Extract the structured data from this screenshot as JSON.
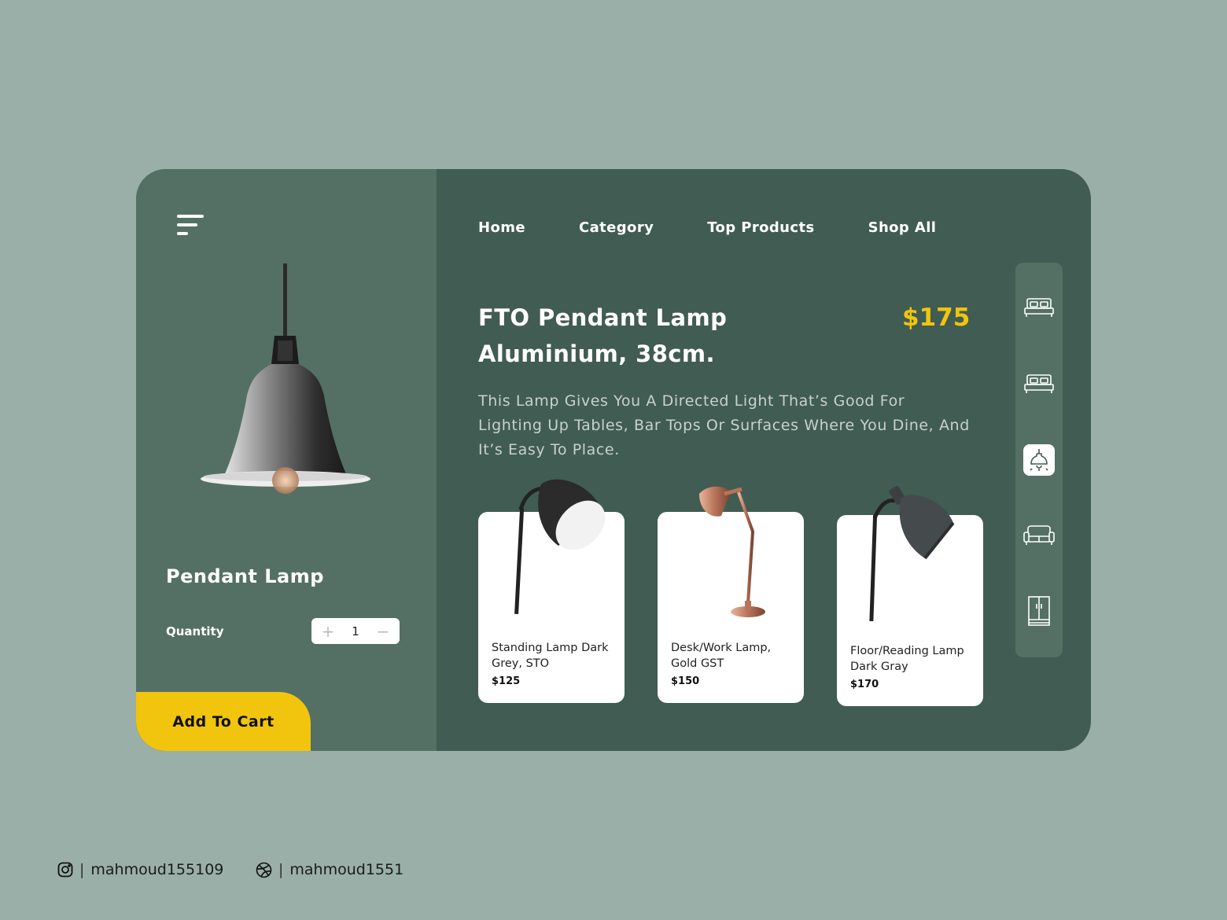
{
  "colors": {
    "accent": "#f1c50e",
    "panel_dark": "#415c52",
    "panel_light": "#547064",
    "background": "#9aafa8"
  },
  "product": {
    "name": "Pendant Lamp",
    "quantity_label": "Quantity",
    "quantity": "1",
    "plus": "+",
    "minus": "−",
    "add_to_cart": "Add To Cart"
  },
  "nav": {
    "items": [
      "Home",
      "Category",
      "Top Products",
      "Shop All"
    ]
  },
  "main": {
    "title": "FTO Pendant Lamp Aluminium, 38cm.",
    "price": "$175",
    "description": "This Lamp Gives You A Directed Light That’s Good For Lighting Up Tables, Bar Tops Or Surfaces Where You Dine, And It’s Easy To Place."
  },
  "products": [
    {
      "name": "Standing Lamp Dark Grey, STO",
      "price": "$125"
    },
    {
      "name": "Desk/Work Lamp, Gold GST",
      "price": "$150"
    },
    {
      "name": "Floor/Reading Lamp Dark Gray",
      "price": "$170"
    }
  ],
  "sidebar": {
    "icons": [
      "bed-icon",
      "double-bed-icon",
      "pendant-lamp-icon",
      "sofa-icon",
      "wardrobe-icon"
    ],
    "active": "pendant-lamp-icon"
  },
  "footer": {
    "instagram": "mahmoud155109",
    "dribbble": "mahmoud1551",
    "separator": "|"
  }
}
